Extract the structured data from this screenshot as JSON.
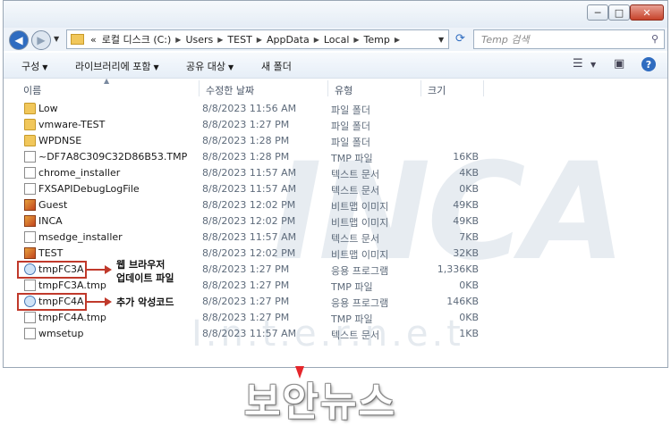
{
  "window": {
    "minimize": "─",
    "maximize": "□",
    "close": "✕"
  },
  "address": {
    "prefix": "«",
    "crumbs": [
      "로컬 디스크 (C:)",
      "Users",
      "TEST",
      "AppData",
      "Local",
      "Temp"
    ],
    "search_placeholder": "Temp 검색"
  },
  "toolbar": {
    "organize": "구성",
    "include_library": "라이브러리에 포함",
    "share": "공유 대상",
    "new_folder": "새 폴더"
  },
  "columns": {
    "name": "이름",
    "date": "수정한 날짜",
    "type": "유형",
    "size": "크기"
  },
  "files": [
    {
      "name": "Low",
      "date": "8/8/2023 11:56 AM",
      "type": "파일 폴더",
      "size": "",
      "icon": "folder-icon"
    },
    {
      "name": "vmware-TEST",
      "date": "8/8/2023 1:27 PM",
      "type": "파일 폴더",
      "size": "",
      "icon": "folder-icon"
    },
    {
      "name": "WPDNSE",
      "date": "8/8/2023 1:28 PM",
      "type": "파일 폴더",
      "size": "",
      "icon": "folder-icon"
    },
    {
      "name": "~DF7A8C309C32D86B53.TMP",
      "date": "8/8/2023 1:28 PM",
      "type": "TMP 파일",
      "size": "16KB",
      "icon": "file-icon"
    },
    {
      "name": "chrome_installer",
      "date": "8/8/2023 11:57 AM",
      "type": "텍스트 문서",
      "size": "4KB",
      "icon": "file-icon"
    },
    {
      "name": "FXSAPIDebugLogFile",
      "date": "8/8/2023 11:57 AM",
      "type": "텍스트 문서",
      "size": "0KB",
      "icon": "file-icon"
    },
    {
      "name": "Guest",
      "date": "8/8/2023 12:02 PM",
      "type": "비트맵 이미지",
      "size": "49KB",
      "icon": "bitmap-icon"
    },
    {
      "name": "INCA",
      "date": "8/8/2023 12:02 PM",
      "type": "비트맵 이미지",
      "size": "49KB",
      "icon": "bitmap-icon"
    },
    {
      "name": "msedge_installer",
      "date": "8/8/2023 11:57 AM",
      "type": "텍스트 문서",
      "size": "7KB",
      "icon": "file-icon"
    },
    {
      "name": "TEST",
      "date": "8/8/2023 12:02 PM",
      "type": "비트맵 이미지",
      "size": "32KB",
      "icon": "bitmap-icon"
    },
    {
      "name": "tmpFC3A",
      "date": "8/8/2023 1:27 PM",
      "type": "응용 프로그램",
      "size": "1,336KB",
      "icon": "exe-icon"
    },
    {
      "name": "tmpFC3A.tmp",
      "date": "8/8/2023 1:27 PM",
      "type": "TMP 파일",
      "size": "0KB",
      "icon": "file-icon"
    },
    {
      "name": "tmpFC4A",
      "date": "8/8/2023 1:27 PM",
      "type": "응용 프로그램",
      "size": "146KB",
      "icon": "exe-icon"
    },
    {
      "name": "tmpFC4A.tmp",
      "date": "8/8/2023 1:27 PM",
      "type": "TMP 파일",
      "size": "0KB",
      "icon": "file-icon"
    },
    {
      "name": "wmsetup",
      "date": "8/8/2023 11:57 AM",
      "type": "텍스트 문서",
      "size": "1KB",
      "icon": "file-icon"
    }
  ],
  "annotations": {
    "note1_line1": "웹 브라우저",
    "note1_line2": "업데이트 파일",
    "note2": "추가 악성코드"
  },
  "watermark": {
    "big": "INCA",
    "dotted": "I.n.t.e.r.n.e.t"
  },
  "logo": "보안뉴스",
  "colors": {
    "highlight": "#c0392b",
    "logo_accent": "#e5262b"
  }
}
